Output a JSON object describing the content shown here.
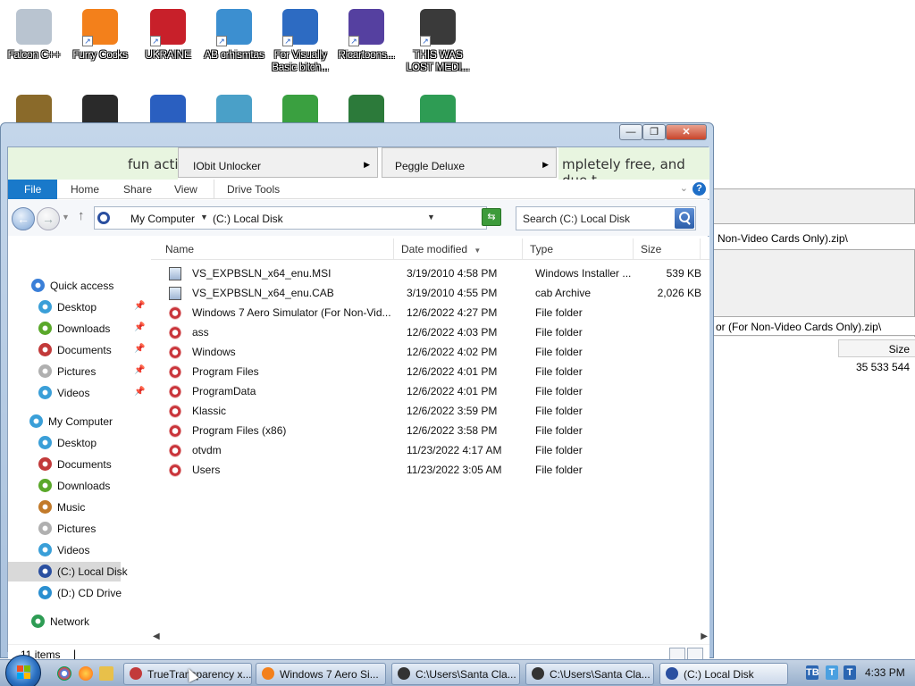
{
  "desktop": {
    "icons": [
      {
        "label": "Falcon C++",
        "color": "#b9c4d0"
      },
      {
        "label": "Furry Cocks",
        "color": "#f3801b"
      },
      {
        "label": "UKRAINE",
        "color": "#c8202a"
      },
      {
        "label": "AB crhismtas",
        "color": "#3c8fd0"
      },
      {
        "label": "For Visually Basic bitch...",
        "color": "#2d6bc2"
      },
      {
        "label": "Ricartoons...",
        "color": "#5540a0"
      },
      {
        "label": "THIS WAS LOST MEDI...",
        "color": "#3a3a3a"
      }
    ],
    "icons_row2": [
      {
        "name": "money-bag-icon",
        "color": "#8a6a2a"
      },
      {
        "name": "bird-icon",
        "color": "#2a2a2a"
      },
      {
        "name": "superman-icon",
        "color": "#2a5fc0"
      },
      {
        "name": "house-icon",
        "color": "#4aa0c8"
      },
      {
        "name": "frog-icon",
        "color": "#3aa040"
      },
      {
        "name": "tree-icon",
        "color": "#2c7a3a"
      },
      {
        "name": "csharp-icon",
        "color": "#2e9c54"
      }
    ]
  },
  "explorer": {
    "caption": {
      "minimize": "—",
      "maximize": "❐",
      "close": "✕"
    },
    "ad": {
      "left_text": "fun acti",
      "right_text": "mpletely free, and due t",
      "menu1_item": "IObit Unlocker",
      "menu2_item": "Peggle Deluxe"
    },
    "ribbon": {
      "tabs": [
        "File",
        "Home",
        "Share",
        "View",
        "Drive Tools"
      ]
    },
    "address": {
      "crumbs": [
        "My Computer",
        "(C:) Local Disk"
      ],
      "search_placeholder": "Search (C:) Local Disk"
    },
    "nav": {
      "quick_access": "Quick access",
      "quick_items": [
        {
          "label": "Desktop",
          "color": "#3a9fd8"
        },
        {
          "label": "Downloads",
          "color": "#5aa82a"
        },
        {
          "label": "Documents",
          "color": "#c23a3a"
        },
        {
          "label": "Pictures",
          "color": "#b0b0b0"
        },
        {
          "label": "Videos",
          "color": "#3a9fd8"
        }
      ],
      "my_computer": "My Computer",
      "computer_items": [
        {
          "label": "Desktop",
          "color": "#3a9fd8"
        },
        {
          "label": "Documents",
          "color": "#c23a3a"
        },
        {
          "label": "Downloads",
          "color": "#5aa82a"
        },
        {
          "label": "Music",
          "color": "#c27a2a"
        },
        {
          "label": "Pictures",
          "color": "#b0b0b0"
        },
        {
          "label": "Videos",
          "color": "#3a9fd8"
        },
        {
          "label": "(C:) Local Disk",
          "color": "#2a4fa0"
        },
        {
          "label": "(D:) CD Drive",
          "color": "#2a8fd0"
        }
      ],
      "network": "Network"
    },
    "columns": {
      "name": "Name",
      "date": "Date modified",
      "type": "Type",
      "size": "Size"
    },
    "files": [
      {
        "name": "VS_EXPBSLN_x64_enu.MSI",
        "date": "3/19/2010 4:58 PM",
        "type": "Windows Installer ...",
        "size": "539 KB",
        "kind": "file"
      },
      {
        "name": "VS_EXPBSLN_x64_enu.CAB",
        "date": "3/19/2010 4:55 PM",
        "type": "cab Archive",
        "size": "2,026 KB",
        "kind": "file"
      },
      {
        "name": "Windows 7 Aero Simulator (For Non-Vid...",
        "date": "12/6/2022 4:27 PM",
        "type": "File folder",
        "size": "",
        "kind": "folder"
      },
      {
        "name": "ass",
        "date": "12/6/2022 4:03 PM",
        "type": "File folder",
        "size": "",
        "kind": "folder"
      },
      {
        "name": "Windows",
        "date": "12/6/2022 4:02 PM",
        "type": "File folder",
        "size": "",
        "kind": "folder"
      },
      {
        "name": "Program Files",
        "date": "12/6/2022 4:01 PM",
        "type": "File folder",
        "size": "",
        "kind": "folder"
      },
      {
        "name": "ProgramData",
        "date": "12/6/2022 4:01 PM",
        "type": "File folder",
        "size": "",
        "kind": "folder"
      },
      {
        "name": "Klassic",
        "date": "12/6/2022 3:59 PM",
        "type": "File folder",
        "size": "",
        "kind": "folder"
      },
      {
        "name": "Program Files (x86)",
        "date": "12/6/2022 3:58 PM",
        "type": "File folder",
        "size": "",
        "kind": "folder"
      },
      {
        "name": "otvdm",
        "date": "11/23/2022 4:17 AM",
        "type": "File folder",
        "size": "",
        "kind": "folder"
      },
      {
        "name": "Users",
        "date": "11/23/2022 3:05 AM",
        "type": "File folder",
        "size": "",
        "kind": "folder"
      }
    ],
    "status": {
      "count": "11 items",
      "cursor": "|"
    }
  },
  "bg_window": {
    "path1": "Non-Video Cards Only).zip\\",
    "path2": "or (For Non-Video Cards Only).zip\\",
    "size_header": "Size",
    "size_value": "35 533 544"
  },
  "taskbar": {
    "tasks": [
      {
        "label": "TrueTransparency x...",
        "color": "#c23a3a"
      },
      {
        "label": "Windows 7 Aero Si...",
        "color": "#f3801b"
      },
      {
        "label": "C:\\Users\\Santa Cla...",
        "color": "#333333"
      },
      {
        "label": "C:\\Users\\Santa Cla...",
        "color": "#333333"
      },
      {
        "label": "(C:) Local Disk",
        "color": "#2a4fa0"
      }
    ],
    "tray": [
      "TB",
      "T",
      "T"
    ],
    "clock": "4:33 PM"
  }
}
